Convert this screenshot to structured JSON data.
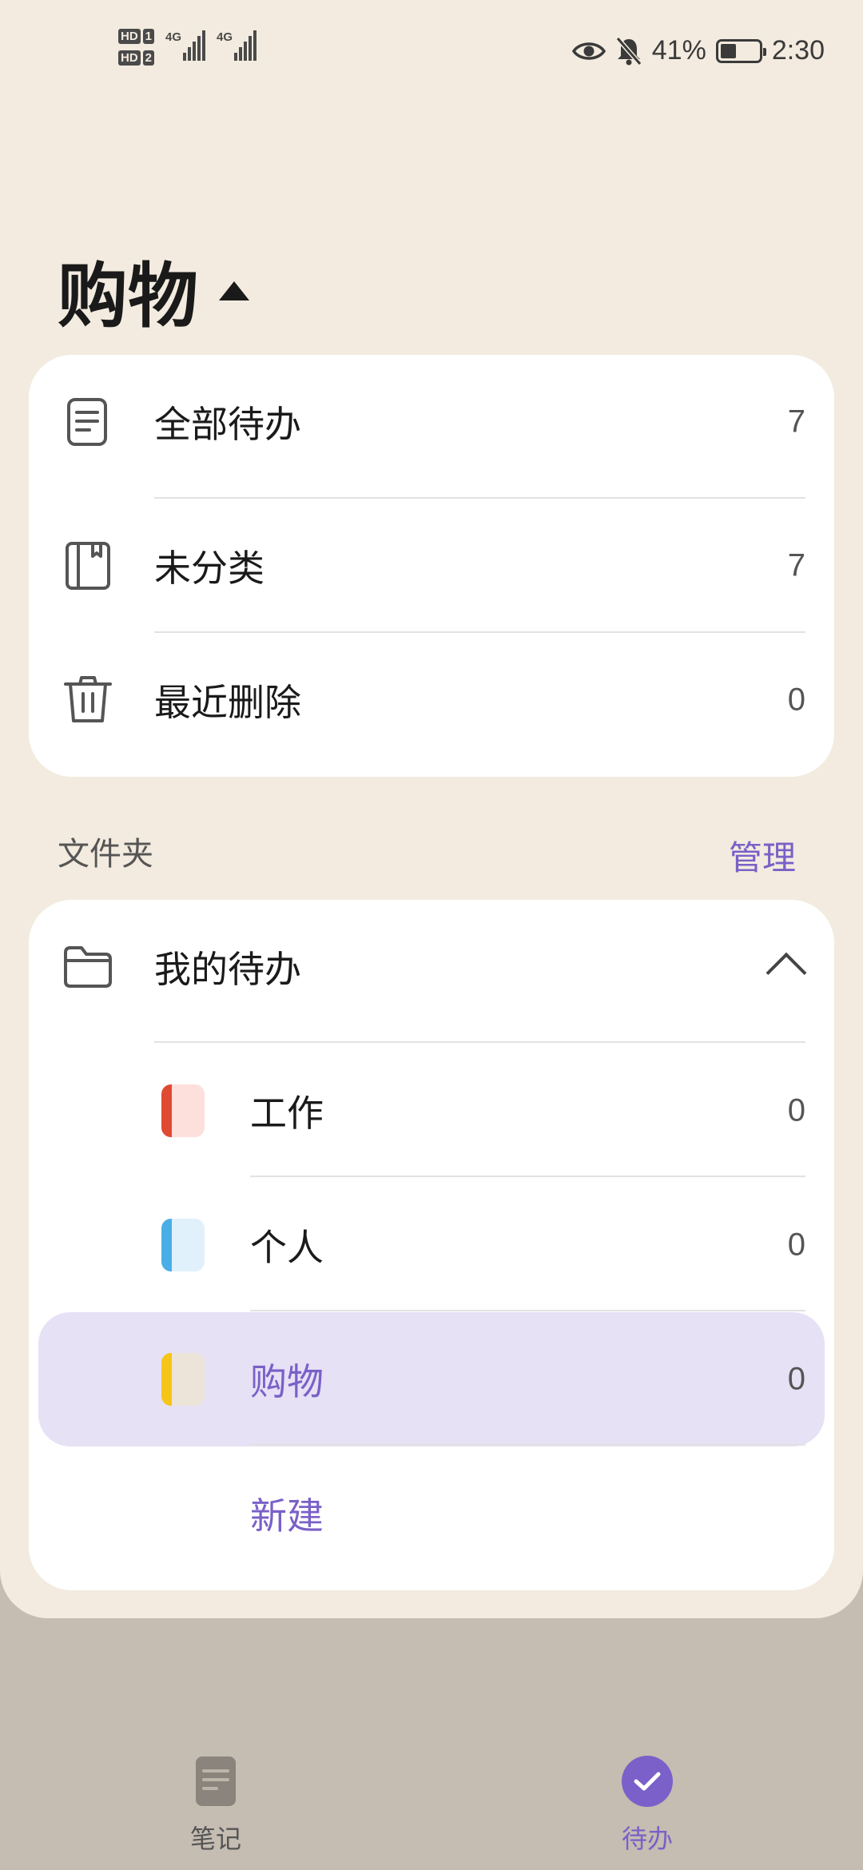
{
  "status_bar": {
    "hd1": "HD",
    "sim1": "1",
    "hd2": "HD",
    "sim2": "2",
    "net1": "4G",
    "net2": "4G",
    "battery_percent": "41%",
    "battery_level": 0.41,
    "time": "2:30"
  },
  "header": {
    "title": "购物"
  },
  "smart_lists": [
    {
      "label": "全部待办",
      "count": "7",
      "icon": "document-icon"
    },
    {
      "label": "未分类",
      "count": "7",
      "icon": "book-icon"
    },
    {
      "label": "最近删除",
      "count": "0",
      "icon": "trash-icon"
    }
  ],
  "folders": {
    "section_title": "文件夹",
    "manage_label": "管理",
    "group": {
      "label": "我的待办",
      "icon": "folder-icon"
    },
    "items": [
      {
        "label": "工作",
        "count": "0",
        "edge": "#e04a32",
        "fill": "#fde0dc"
      },
      {
        "label": "个人",
        "count": "0",
        "edge": "#4aaee6",
        "fill": "#e0f1fc"
      },
      {
        "label": "购物",
        "count": "0",
        "edge": "#f5c518",
        "fill": "#ece4d8",
        "selected": true
      }
    ],
    "new_label": "新建"
  },
  "bottom_nav": {
    "notes_label": "笔记",
    "todo_label": "待办"
  },
  "colors": {
    "accent": "#7a60c8",
    "sheet_bg": "#f3ebdf",
    "nav_bg": "#c5bcb2",
    "selected_bg": "#e6e1f5"
  }
}
